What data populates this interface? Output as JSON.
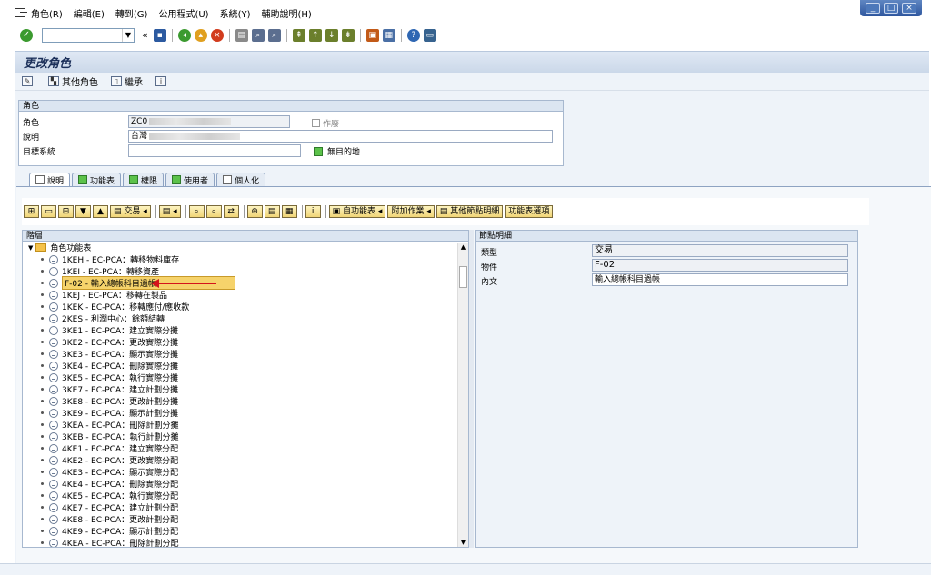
{
  "menu": [
    "角色(R)",
    "編輯(E)",
    "轉到(G)",
    "公用程式(U)",
    "系統(Y)",
    "輔助說明(H)"
  ],
  "window_controls": [
    "_",
    "□",
    "×"
  ],
  "std_toolbar": {
    "back_symbol": "«"
  },
  "title": "更改角色",
  "app_toolbar": {
    "other_role": "其他角色",
    "inherit": "繼承"
  },
  "role_group": {
    "title": "角色",
    "role_label": "角色",
    "role_value": "ZC0",
    "obsolete_label": "作廢",
    "desc_label": "說明",
    "desc_value": "台灣",
    "target_label": "目標系統",
    "target_value": "",
    "no_destination": "無目的地"
  },
  "tabs": [
    "說明",
    "功能表",
    "權限",
    "使用者",
    "個人化"
  ],
  "tree_toolbar": {
    "transaction": "交易",
    "from_menu": "自功能表",
    "add_job": "附加作業",
    "other_node_details": "其他節點明細",
    "menu_options": "功能表選項"
  },
  "tree": {
    "header": "階層",
    "root": "角色功能表",
    "nodes": [
      "1KEH - EC-PCA：轉移物料庫存",
      "1KEI - EC-PCA：轉移資產",
      "F-02 - 輸入總帳科目過帳",
      "1KEJ - EC-PCA：移轉在製品",
      "1KEK - EC-PCA：移轉應付/應收款",
      "2KES - 利潤中心：餘額結轉",
      "3KE1 - EC-PCA：建立實際分攤",
      "3KE2 - EC-PCA：更改實際分攤",
      "3KE3 - EC-PCA：顯示實際分攤",
      "3KE4 - EC-PCA：刪除實際分攤",
      "3KE5 - EC-PCA：執行實際分攤",
      "3KE7 - EC-PCA：建立計劃分攤",
      "3KE8 - EC-PCA：更改計劃分攤",
      "3KE9 - EC-PCA：顯示計劃分攤",
      "3KEA - EC-PCA：刪除計劃分攤",
      "3KEB - EC-PCA：執行計劃分攤",
      "4KE1 - EC-PCA：建立實際分配",
      "4KE2 - EC-PCA：更改實際分配",
      "4KE3 - EC-PCA：顯示實際分配",
      "4KE4 - EC-PCA：刪除實際分配",
      "4KE5 - EC-PCA：執行實際分配",
      "4KE7 - EC-PCA：建立計劃分配",
      "4KE8 - EC-PCA：更改計劃分配",
      "4KE9 - EC-PCA：顯示計劃分配",
      "4KEA - EC-PCA：刪除計劃分配"
    ],
    "selected_index": 2
  },
  "node_details": {
    "header": "節點明細",
    "type_label": "類型",
    "type_value": "交易",
    "object_label": "物件",
    "object_value": "F-02",
    "text_label": "內文",
    "text_value": "輸入總帳科目過帳"
  },
  "colors": {
    "tab_green": "#5cc24a",
    "selection": "#f6d36b",
    "arrow": "#d4141c"
  }
}
